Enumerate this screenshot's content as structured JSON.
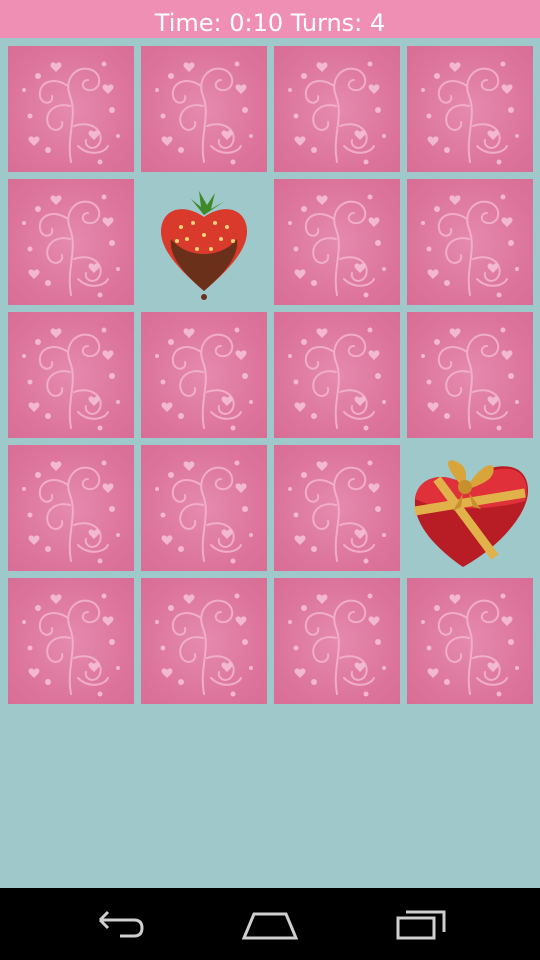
{
  "header": {
    "time_label": "Time:",
    "time_value": "0:10",
    "turns_label": "Turns:",
    "turns_value": "4"
  },
  "board": {
    "rows": 5,
    "cols": 4,
    "cards": [
      {
        "state": "back"
      },
      {
        "state": "back"
      },
      {
        "state": "back"
      },
      {
        "state": "back"
      },
      {
        "state": "back"
      },
      {
        "state": "face",
        "icon": "strawberry-icon"
      },
      {
        "state": "back"
      },
      {
        "state": "back"
      },
      {
        "state": "back"
      },
      {
        "state": "back"
      },
      {
        "state": "back"
      },
      {
        "state": "back"
      },
      {
        "state": "back"
      },
      {
        "state": "back"
      },
      {
        "state": "back"
      },
      {
        "state": "face",
        "icon": "heart-gift-box-icon"
      },
      {
        "state": "back"
      },
      {
        "state": "back"
      },
      {
        "state": "back"
      },
      {
        "state": "back"
      }
    ]
  },
  "colors": {
    "header_bg": "#f08fb4",
    "board_bg": "#9fc8cb",
    "card_back": "#dd7a9f"
  },
  "navbar": {
    "buttons": [
      "back-icon",
      "home-icon",
      "recent-apps-icon"
    ]
  }
}
